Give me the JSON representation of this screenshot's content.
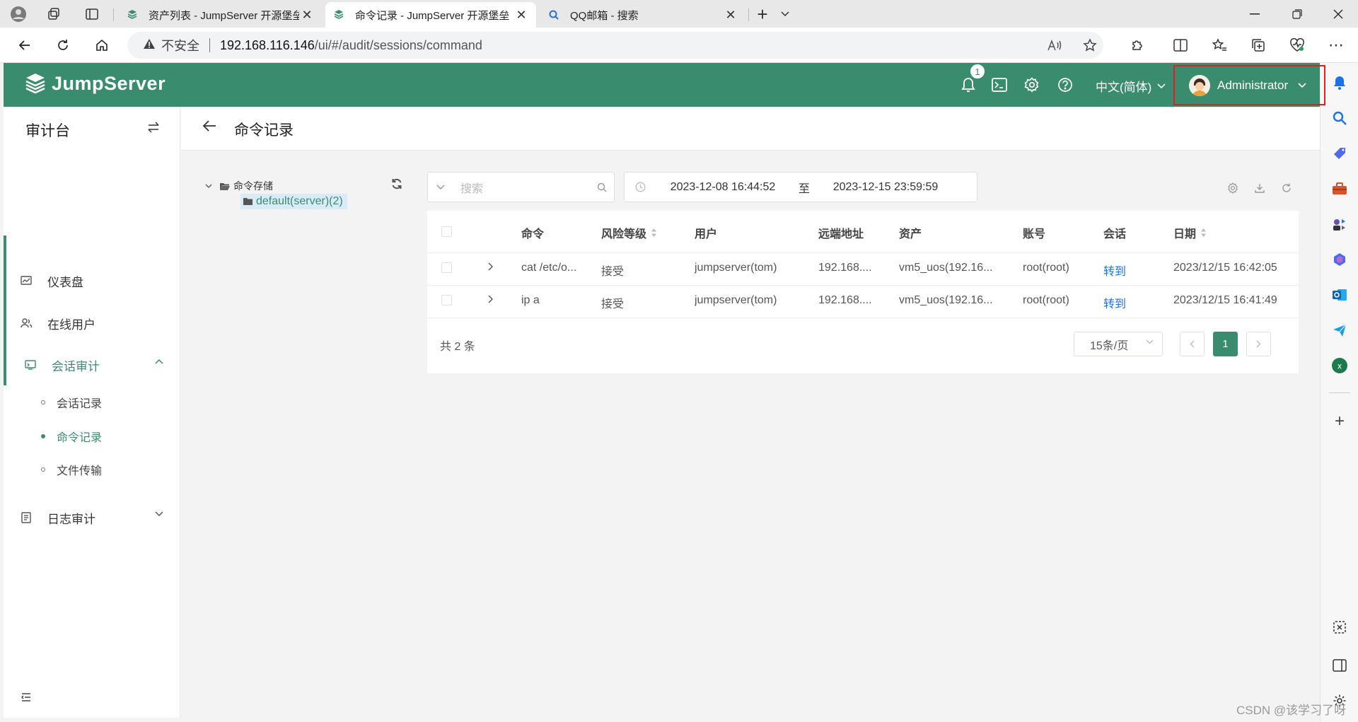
{
  "browser": {
    "tabs": [
      {
        "title": "资产列表 - JumpServer 开源堡垒",
        "active": false
      },
      {
        "title": "命令记录 - JumpServer 开源堡垒",
        "active": true
      },
      {
        "title": "QQ邮箱 - 搜索",
        "active": false
      }
    ],
    "new_tab": "+",
    "url": {
      "not_secure": "不安全",
      "host": "192.168.116.146",
      "path": "/ui/#/audit/sessions/command"
    }
  },
  "header": {
    "brand": "JumpServer",
    "notification_count": "1",
    "language": "中文(简体)",
    "user": "Administrator",
    "brand_color": "#3a8c6f"
  },
  "sidebar": {
    "title": "审计台",
    "items": [
      {
        "label": "仪表盘",
        "icon": "dashboard-icon"
      },
      {
        "label": "在线用户",
        "icon": "users-icon"
      },
      {
        "label": "会话审计",
        "icon": "session-audit-icon",
        "expanded": true,
        "children": [
          {
            "label": "会话记录",
            "active": false
          },
          {
            "label": "命令记录",
            "active": true
          },
          {
            "label": "文件传输",
            "active": false
          }
        ]
      },
      {
        "label": "日志审计",
        "icon": "log-audit-icon",
        "expanded": false
      }
    ]
  },
  "page": {
    "title": "命令记录"
  },
  "tree": {
    "root": "命令存储",
    "child": "default(server)(2)"
  },
  "toolbar": {
    "search_placeholder": "搜索",
    "date_start": "2023-12-08 16:44:52",
    "date_separator": "至",
    "date_end": "2023-12-15 23:59:59"
  },
  "table": {
    "columns": [
      "命令",
      "风险等级",
      "用户",
      "远端地址",
      "资产",
      "账号",
      "会话",
      "日期"
    ],
    "rows": [
      {
        "command": "cat /etc/o...",
        "risk": "接受",
        "user": "jumpserver(tom)",
        "remote": "192.168....",
        "asset": "vm5_uos(192.16...",
        "account": "root(root)",
        "session": "转到",
        "date": "2023/12/15 16:42:05"
      },
      {
        "command": "ip a",
        "risk": "接受",
        "user": "jumpserver(tom)",
        "remote": "192.168....",
        "asset": "vm5_uos(192.16...",
        "account": "root(root)",
        "session": "转到",
        "date": "2023/12/15 16:41:49"
      }
    ]
  },
  "pagination": {
    "total": "共 2 条",
    "page_size": "15条/页",
    "current_page": "1"
  },
  "watermark": "CSDN @该学习了呀"
}
